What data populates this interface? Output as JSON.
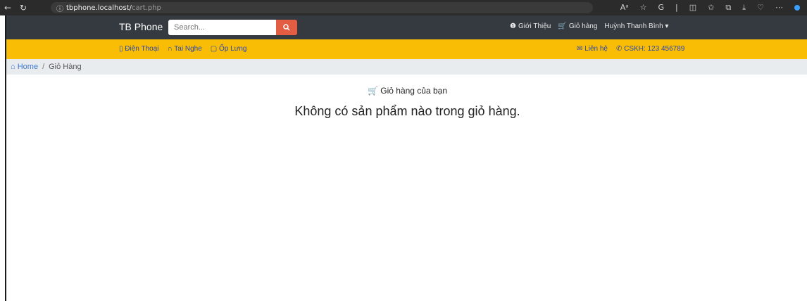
{
  "browser": {
    "url_host": "tbphone.localhost/",
    "url_path": "cart.php",
    "back_icon": "←",
    "reload_icon": "↻",
    "info_icon": "ⓘ",
    "tools": [
      "Aᵃ",
      "☆",
      "G",
      "|",
      "◫",
      "✩",
      "⧉",
      "⤓",
      "♡",
      "⋯"
    ]
  },
  "navbar": {
    "brand": "TB Phone",
    "search_placeholder": "Search...",
    "intro_label": "Giới Thiệu",
    "cart_label": "Giỏ hàng",
    "user_label": "Huỳnh Thanh Bình"
  },
  "categories": {
    "phones": "Điện Thoại",
    "headphones": "Tai Nghe",
    "cases": "Ốp Lưng"
  },
  "contact": {
    "contact_label": "Liên hệ",
    "hotline_label": "CSKH: 123 456789"
  },
  "breadcrumb": {
    "home": "Home",
    "current": "Giỏ Hàng"
  },
  "cart": {
    "title": "Giỏ hàng của bạn",
    "empty_message": "Không có sản phẩm nào trong giỏ hàng."
  },
  "colors": {
    "navbar_bg": "#343a40",
    "yellow_bar": "#f9bd06",
    "search_button": "#e35d42",
    "link_blue": "#2b47b0"
  }
}
